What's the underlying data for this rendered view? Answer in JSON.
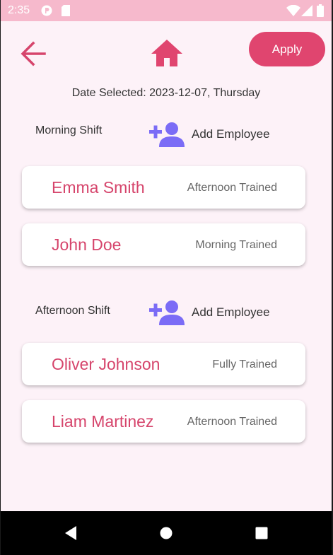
{
  "status_bar": {
    "time": "2:35",
    "icons": [
      "p-notification-icon",
      "sd-card-icon",
      "wifi-icon",
      "signal-icon",
      "battery-icon"
    ]
  },
  "toolbar": {
    "back_icon": "arrow-left-icon",
    "home_icon": "home-icon",
    "apply_label": "Apply"
  },
  "date_text": "Date Selected: 2023-12-07, Thursday",
  "shifts": [
    {
      "label": "Morning Shift",
      "add_label": "Add Employee",
      "employees": [
        {
          "name": "Emma Smith",
          "training": "Afternoon Trained"
        },
        {
          "name": "John Doe",
          "training": "Morning Trained"
        }
      ]
    },
    {
      "label": "Afternoon Shift",
      "add_label": "Add Employee",
      "employees": [
        {
          "name": "Oliver Johnson",
          "training": "Fully Trained"
        },
        {
          "name": "Liam Martinez",
          "training": "Afternoon Trained"
        }
      ]
    }
  ],
  "colors": {
    "accent": "#e0456f",
    "name_text": "#d6456c",
    "add_icon": "#7b6cf6",
    "status_bar": "#f6b9cc",
    "background": "#fdf2f8"
  },
  "nav_bar": {
    "icons": [
      "back-triangle-icon",
      "home-circle-icon",
      "recents-square-icon"
    ]
  }
}
